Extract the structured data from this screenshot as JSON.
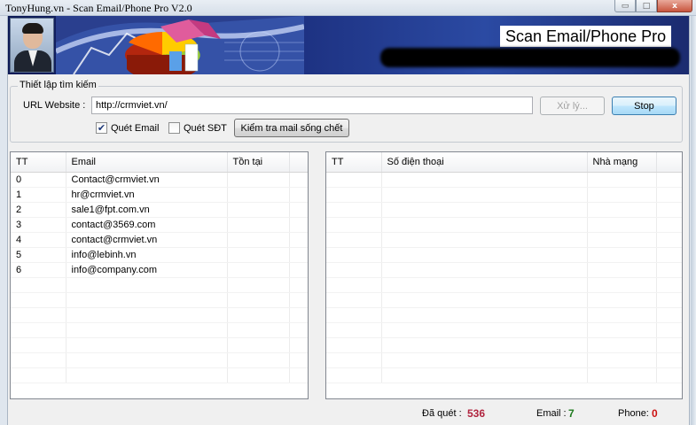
{
  "window": {
    "title": "TonyHung.vn - Scan Email/Phone Pro V2.0",
    "buttons": {
      "minimize": "▭",
      "maximize": "□",
      "close": "x"
    }
  },
  "banner": {
    "title": "Scan Email/Phone Pro"
  },
  "settings": {
    "legend": "Thiết lập tìm kiếm",
    "url_label": "URL Website :",
    "url_value": "http://crmviet.vn/",
    "process_button": "Xử lý...",
    "stop_button": "Stop",
    "scan_email_label": "Quét Email",
    "scan_email_checked": true,
    "scan_phone_label": "Quét SĐT",
    "scan_phone_checked": false,
    "check_mail_button": "Kiểm tra mail sống chết"
  },
  "email_table": {
    "columns": [
      "TT",
      "Email",
      "Tồn tại"
    ],
    "rows": [
      [
        "0",
        "Contact@crmviet.vn",
        ""
      ],
      [
        "1",
        "hr@crmviet.vn",
        ""
      ],
      [
        "2",
        "sale1@fpt.com.vn",
        ""
      ],
      [
        "3",
        "contact@3569.com",
        ""
      ],
      [
        "4",
        "contact@crmviet.vn",
        ""
      ],
      [
        "5",
        "info@lebinh.vn",
        ""
      ],
      [
        "6",
        "info@company.com",
        ""
      ]
    ]
  },
  "phone_table": {
    "columns": [
      "TT",
      "Số điện thoại",
      "Nhà mạng"
    ],
    "rows": []
  },
  "status": {
    "scanned_label": "Đã quét :",
    "scanned_value": "536",
    "email_label": "Email :",
    "email_value": "7",
    "phone_label": "Phone:",
    "phone_value": "0"
  },
  "colors": {
    "scanned": "#b0233e",
    "email": "#1d7a1d",
    "phone": "#cc1111"
  }
}
